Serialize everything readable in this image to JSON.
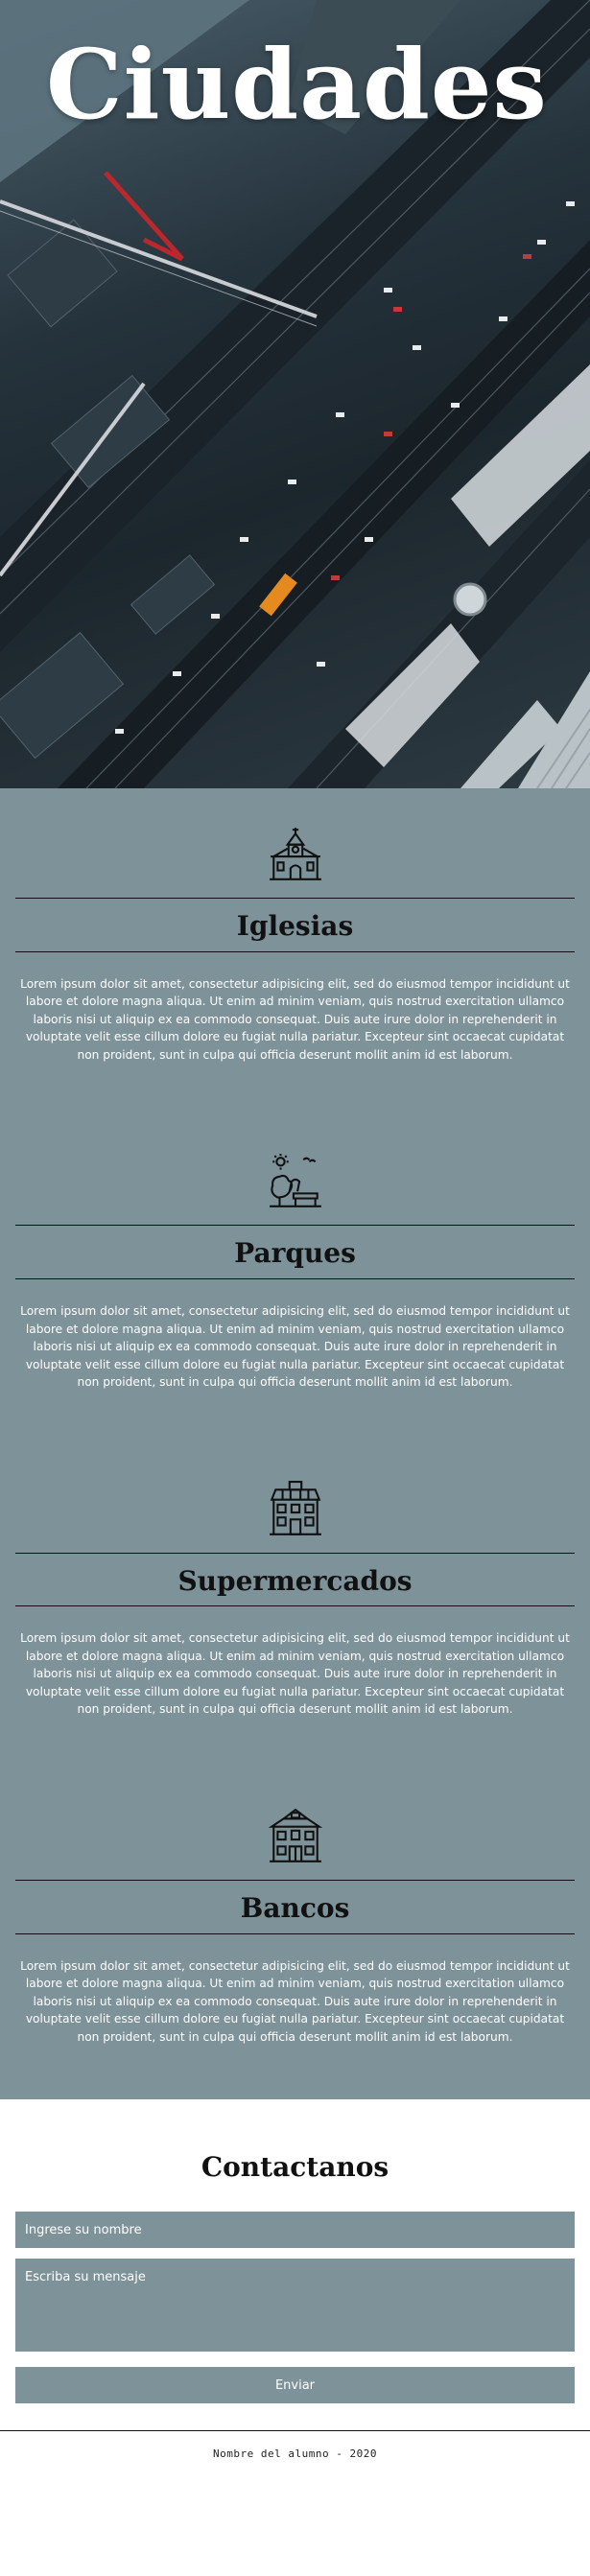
{
  "hero": {
    "title": "Ciudades"
  },
  "services": [
    {
      "icon": "church-icon",
      "title": "Iglesias",
      "text": "Lorem ipsum dolor sit amet, consectetur adipisicing elit, sed do eiusmod tempor incididunt ut labore et dolore magna aliqua. Ut enim ad minim veniam, quis nostrud exercitation ullamco laboris nisi ut aliquip ex ea commodo consequat. Duis aute irure dolor in reprehenderit in voluptate velit esse cillum dolore eu fugiat nulla pariatur. Excepteur sint occaecat cupidatat non proident, sunt in culpa qui officia deserunt mollit anim id est laborum."
    },
    {
      "icon": "park-icon",
      "title": "Parques",
      "text": "Lorem ipsum dolor sit amet, consectetur adipisicing elit, sed do eiusmod tempor incididunt ut labore et dolore magna aliqua. Ut enim ad minim veniam, quis nostrud exercitation ullamco laboris nisi ut aliquip ex ea commodo consequat. Duis aute irure dolor in reprehenderit in voluptate velit esse cillum dolore eu fugiat nulla pariatur. Excepteur sint occaecat cupidatat non proident, sunt in culpa qui officia deserunt mollit anim id est laborum."
    },
    {
      "icon": "supermarket-icon",
      "title": "Supermercados",
      "text": "Lorem ipsum dolor sit amet, consectetur adipisicing elit, sed do eiusmod tempor incididunt ut labore et dolore magna aliqua. Ut enim ad minim veniam, quis nostrud exercitation ullamco laboris nisi ut aliquip ex ea commodo consequat. Duis aute irure dolor in reprehenderit in voluptate velit esse cillum dolore eu fugiat nulla pariatur. Excepteur sint occaecat cupidatat non proident, sunt in culpa qui officia deserunt mollit anim id est laborum."
    },
    {
      "icon": "bank-icon",
      "title": "Bancos",
      "text": "Lorem ipsum dolor sit amet, consectetur adipisicing elit, sed do eiusmod tempor incididunt ut labore et dolore magna aliqua. Ut enim ad minim veniam, quis nostrud exercitation ullamco laboris nisi ut aliquip ex ea commodo consequat. Duis aute irure dolor in reprehenderit in voluptate velit esse cillum dolore eu fugiat nulla pariatur. Excepteur sint occaecat cupidatat non proident, sunt in culpa qui officia deserunt mollit anim id est laborum."
    }
  ],
  "contact": {
    "title": "Contactanos",
    "name_placeholder": "Ingrese su nombre",
    "message_placeholder": "Escriba su mensaje",
    "submit_label": "Enviar"
  },
  "footer": {
    "text": "Nombre del alumno - 2020"
  },
  "colors": {
    "section_bg": "#7e9299",
    "text_light": "#ffffff",
    "text_dark": "#111111"
  }
}
